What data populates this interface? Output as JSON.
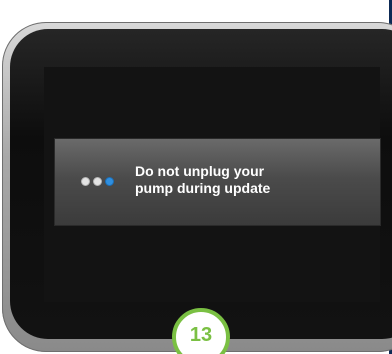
{
  "dialog": {
    "message_line1": "Do not unplug your",
    "message_line2": "pump during update",
    "progress_dots": [
      "inactive",
      "inactive",
      "active"
    ]
  },
  "step_badge": {
    "number": "13"
  },
  "colors": {
    "active_dot": "#2f8fe0",
    "inactive_dot": "#e3e3e3",
    "badge_accent": "#7ac043",
    "screen_bg": "#131313"
  }
}
